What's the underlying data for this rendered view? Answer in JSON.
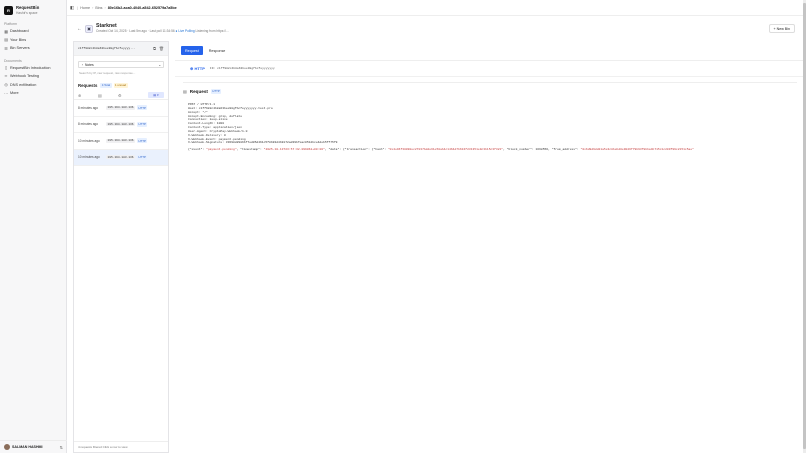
{
  "brand": {
    "name": "RequestBin",
    "workspace": "Hashir's space",
    "logo_text": "R"
  },
  "sidebar": {
    "platform_title": "Platform",
    "platform_items": [
      {
        "label": "Dashboard",
        "icon": "dashboard-icon"
      },
      {
        "label": "Your Bins",
        "icon": "bins-icon"
      },
      {
        "label": "Bin Servers",
        "icon": "server-icon"
      }
    ],
    "documents_title": "Documents",
    "documents_items": [
      {
        "label": "RequestBin Introduction",
        "icon": "book-icon"
      },
      {
        "label": "Webhook Testing",
        "icon": "link-icon"
      },
      {
        "label": "DNS exfiltration",
        "icon": "globe-icon"
      },
      {
        "label": "More",
        "icon": "more-icon"
      }
    ],
    "user": {
      "name": "SALMAN HASHMI"
    }
  },
  "breadcrumbs": [
    "Home",
    "Bins",
    "80e16b2-aca0-4040-a542-652579a7a5be"
  ],
  "bin": {
    "title": "Starknet",
    "meta_prefix": "Created Oct 14, 2025 · Last 5m ago · Last poll 11:34:56",
    "meta_live": "● Live Polling",
    "meta_suffix": " Listening from https://...",
    "new_bin_label": "+ New Bin"
  },
  "left": {
    "token": "c1ff982c4b8a63bee98gfbcfeyyyy...",
    "filter_label": "Notes",
    "search_placeholder": "Search by IP, raw request, raw response...",
    "requests_title": "Requests",
    "total_badge": "4 Total",
    "unread_badge": "1 unread",
    "toolbar": [
      "⊕",
      "▤",
      "⚙"
    ],
    "view_label": "▤ ▾",
    "items": [
      {
        "time": "8 minutes ago",
        "ip": "195.164.183.136",
        "method": "HTTP"
      },
      {
        "time": "8 minutes ago",
        "ip": "195.164.183.136",
        "method": "HTTP"
      },
      {
        "time": "10 minutes ago",
        "ip": "195.164.183.136",
        "method": "HTTP"
      },
      {
        "time": "10 minutes ago",
        "ip": "195.164.183.136",
        "method": "HTTP"
      }
    ],
    "footer": "4 requests filtered    Click a row to view"
  },
  "right": {
    "tabs": [
      "Request",
      "Response"
    ],
    "http_label": "HTTP",
    "http_id": "ID: c1ff982c4b8a63bee98gfbcfeyyyyyyy",
    "card_title": "Request",
    "card_badge": "HTTP",
    "raw_lines": [
      "POST / HTTP/1.1",
      "Host: c1ff982c4b8a63bee98gfbcfeyyyyyyy-test.pro",
      "Accept: */*",
      "Accept-Encoding: gzip, deflate",
      "Connection: keep-alive",
      "Content-Length: 1000",
      "Content-Type: application/json",
      "User-Agent: CryptoPay-Webhook/1.0",
      "X-Webhook-Delivery: 0",
      "X-Webhook-Event: payment.pending",
      "X-Webhook-Signature: 33698d2986bf7ed05d461c5f8b93d4b9172ad39bfeac0512bce4deb5ff75f9"
    ],
    "body_parts": [
      {
        "t": "{\"event\": ",
        "c": "jk"
      },
      {
        "t": "\"payment.pending\"",
        "c": "js"
      },
      {
        "t": ", \"timestamp\": ",
        "c": "jk"
      },
      {
        "t": "\"2025-10-13T23:57:32.099062+00:00\"",
        "c": "js"
      },
      {
        "t": ", \"data\": {\"transaction\": {\"hash\": ",
        "c": "jk"
      },
      {
        "t": "\"0x4e96f30090ec27037bdde61e50ab4c1464d7b634f231351e9c3b15c3f321\"",
        "c": "js"
      },
      {
        "t": ", \"block_number\": 1668556, \"from_address\": ",
        "c": "jk"
      },
      {
        "t": "\"0x6d9d9dd21a5e3c8bebd0e9026f79b93f8bba4b715c1c209f99c2151c5ae\"",
        "c": "js"
      }
    ]
  }
}
